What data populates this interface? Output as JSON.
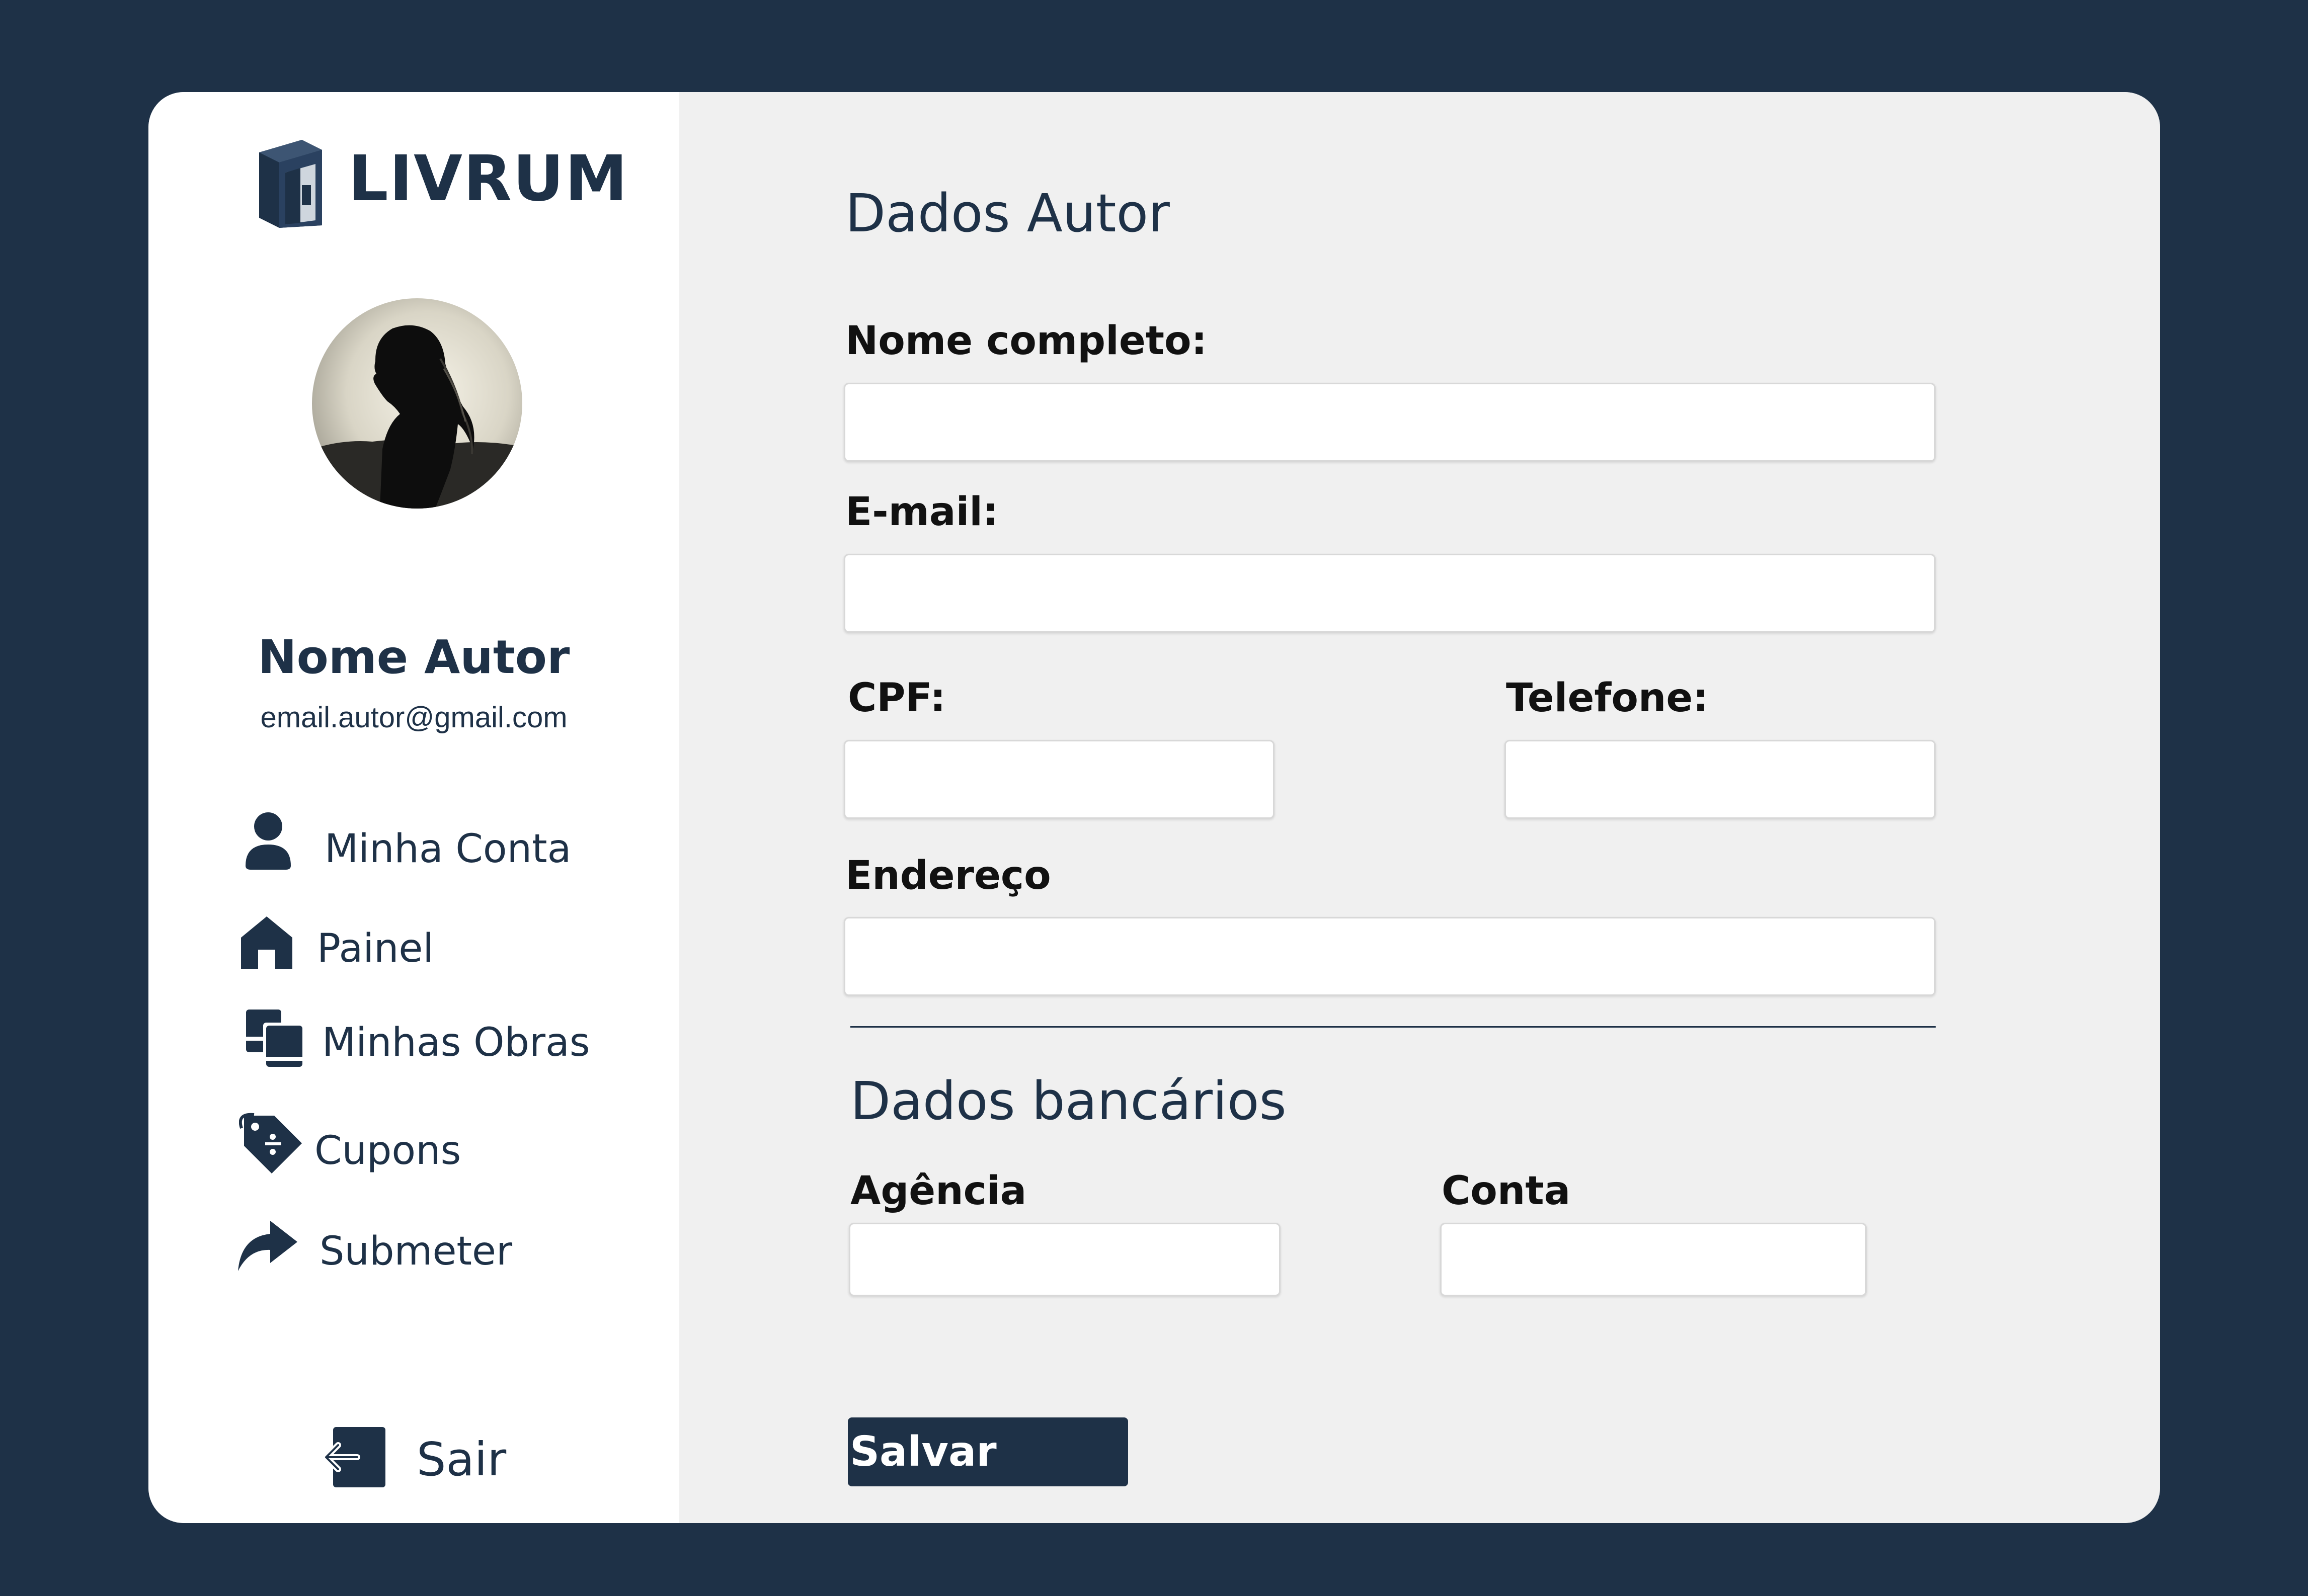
{
  "brand": {
    "name": "LIVRUM",
    "color": "#1e3147",
    "background": "#1e3147"
  },
  "profile": {
    "name": "Nome Autor",
    "email": "email.autor@gmail.com"
  },
  "nav": {
    "items": [
      {
        "label": "Minha Conta",
        "icon": "user-icon"
      },
      {
        "label": "Painel",
        "icon": "home-icon"
      },
      {
        "label": "Minhas Obras",
        "icon": "books-icon"
      },
      {
        "label": "Cupons",
        "icon": "discount-tag-icon"
      },
      {
        "label": "Submeter",
        "icon": "share-arrow-icon"
      }
    ],
    "logout": {
      "label": "Sair",
      "icon": "logout-icon"
    }
  },
  "form": {
    "author_section_title": "Dados Autor",
    "full_name": {
      "label": "Nome completo:",
      "value": ""
    },
    "email": {
      "label": "E-mail:",
      "value": ""
    },
    "cpf": {
      "label": "CPF:",
      "value": ""
    },
    "phone": {
      "label": "Telefone:",
      "value": ""
    },
    "address": {
      "label": "Endereço",
      "value": ""
    },
    "bank_section_title": "Dados bancários",
    "agency": {
      "label": "Agência",
      "value": ""
    },
    "account": {
      "label": "Conta",
      "value": ""
    },
    "save_label": "Salvar"
  }
}
